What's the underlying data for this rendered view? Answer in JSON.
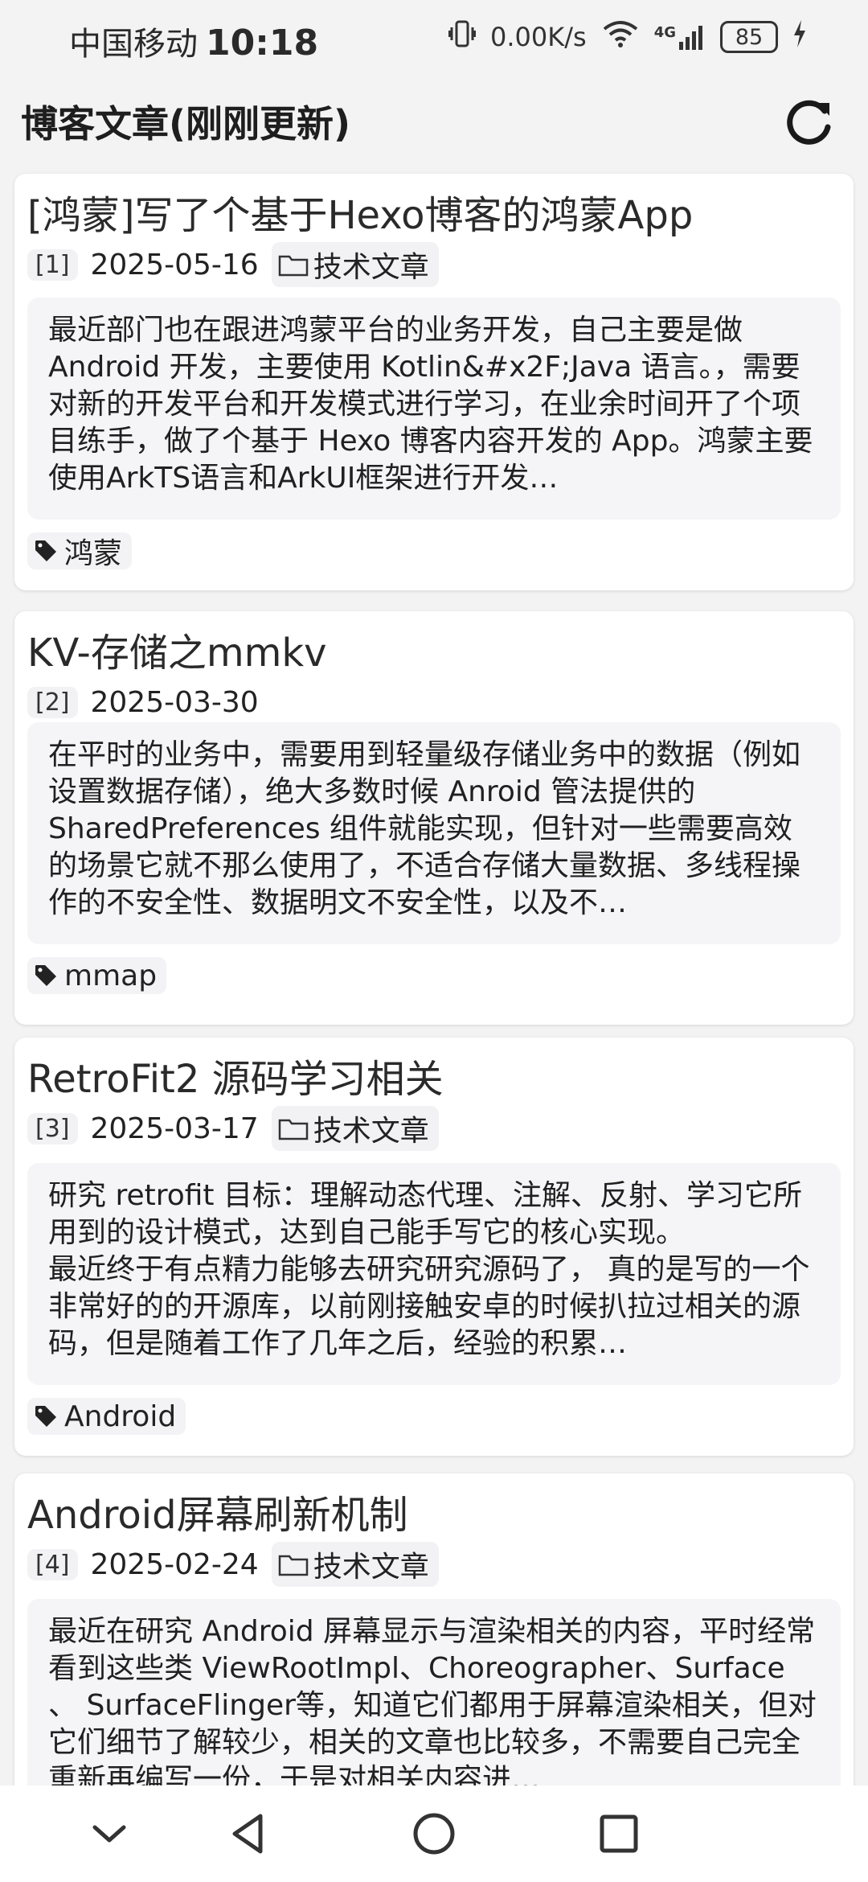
{
  "status": {
    "carrier": "中国移动",
    "time": "10:18",
    "net_speed": "0.00K/s",
    "network": "4G",
    "battery": "85"
  },
  "app_bar": {
    "title": "博客文章(刚刚更新)"
  },
  "posts": [
    {
      "title": "[鸿蒙]写了个基于Hexo博客的鸿蒙App",
      "index": "[1]",
      "date": "2025-05-16",
      "category": "技术文章",
      "excerpt": "最近部门也在跟进鸿蒙平台的业务开发，自己主要是做 Android 开发，主要使用 Kotlin&#x2F;Java 语言。，需要对新的开发平台和开发模式进行学习，在业余时间开了个项目练手，做了个基于 Hexo 博客内容开发的 App。鸿蒙主要使用ArkTS语言和ArkUI框架进行开发…",
      "tag": "鸿蒙"
    },
    {
      "title": "KV-存储之mmkv",
      "index": "[2]",
      "date": "2025-03-30",
      "category": "",
      "excerpt": "在平时的业务中，需要用到轻量级存储业务中的数据（例如设置数据存储），绝大多数时候 Anroid 管法提供的 SharedPreferences 组件就能实现，但针对一些需要高效的场景它就不那么使用了，不适合存储大量数据、多线程操作的不安全性、数据明文不安全性，以及不…",
      "tag": "mmap"
    },
    {
      "title": "RetroFit2 源码学习相关",
      "index": "[3]",
      "date": "2025-03-17",
      "category": "技术文章",
      "excerpt": "研究 retrofit 目标：理解动态代理、注解、反射、学习它所用到的设计模式，达到自己能手写它的核心实现。\n最近终于有点精力能够去研究研究源码了， 真的是写的一个非常好的的开源库，以前刚接触安卓的时候扒拉过相关的源码，但是随着工作了几年之后，经验的积累…",
      "tag": "Android"
    },
    {
      "title": "Android屏幕刷新机制",
      "index": "[4]",
      "date": "2025-02-24",
      "category": "技术文章",
      "excerpt": "最近在研究 Android 屏幕显示与渲染相关的内容，平时经常看到这些类 ViewRootImpl、Choreographer、Surface 、 SurfaceFlinger等，知道它们都用于屏幕渲染相关，但对它们细节了解较少，相关的文章也比较多，不需要自己完全重新再编写一份，于是对相关内容进…",
      "tag": ""
    }
  ],
  "icons": {
    "refresh": "refresh-icon",
    "folder": "folder-icon",
    "tag": "tag-icon",
    "nav": [
      "chevron-down-icon",
      "back-triangle-icon",
      "home-circle-icon",
      "recents-square-icon"
    ]
  }
}
